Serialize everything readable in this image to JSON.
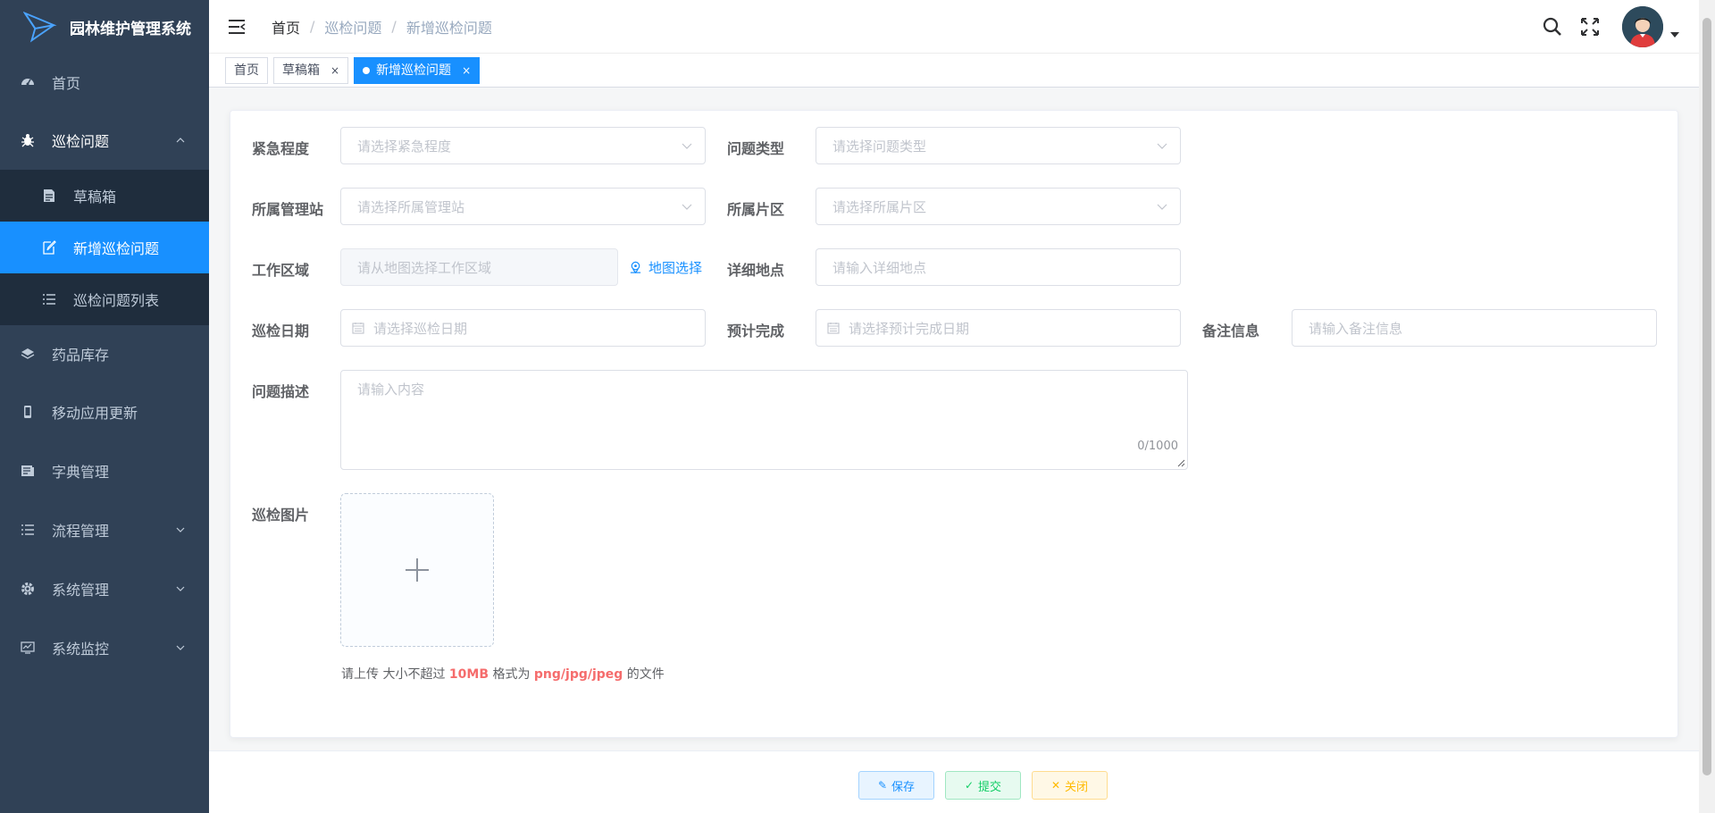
{
  "app": {
    "title": "园林维护管理系统"
  },
  "sidebar": {
    "items": [
      {
        "label": "首页",
        "icon": "dashboard-icon"
      },
      {
        "label": "巡检问题",
        "icon": "bug-icon"
      },
      {
        "label": "药品库存",
        "icon": "layers-icon"
      },
      {
        "label": "移动应用更新",
        "icon": "phone-icon"
      },
      {
        "label": "字典管理",
        "icon": "dict-icon"
      },
      {
        "label": "流程管理",
        "icon": "list-icon"
      },
      {
        "label": "系统管理",
        "icon": "gear-icon"
      },
      {
        "label": "系统监控",
        "icon": "monitor-icon"
      }
    ],
    "submenu": [
      {
        "label": "草稿箱",
        "icon": "document-icon"
      },
      {
        "label": "新增巡检问题",
        "icon": "edit-icon"
      },
      {
        "label": "巡检问题列表",
        "icon": "list-icon"
      }
    ]
  },
  "breadcrumb": {
    "home": "首页",
    "level1": "巡检问题",
    "level2": "新增巡检问题"
  },
  "tags": {
    "home": "首页",
    "draft": "草稿箱",
    "current": "新增巡检问题",
    "close": "×"
  },
  "form": {
    "urgency": {
      "label": "紧急程度",
      "placeholder": "请选择紧急程度"
    },
    "problem_type": {
      "label": "问题类型",
      "placeholder": "请选择问题类型"
    },
    "station": {
      "label": "所属管理站",
      "placeholder": "请选择所属管理站"
    },
    "district": {
      "label": "所属片区",
      "placeholder": "请选择所属片区"
    },
    "work_area": {
      "label": "工作区域",
      "placeholder": "请从地图选择工作区域",
      "map_link": "地图选择"
    },
    "detail_address": {
      "label": "详细地点",
      "placeholder": "请输入详细地点"
    },
    "inspect_date": {
      "label": "巡检日期",
      "placeholder": "请选择巡检日期"
    },
    "expected_date": {
      "label": "预计完成",
      "placeholder": "请选择预计完成日期"
    },
    "remark": {
      "label": "备注信息",
      "placeholder": "请输入备注信息"
    },
    "description": {
      "label": "问题描述",
      "placeholder": "请输入内容",
      "count": "0/1000"
    },
    "images": {
      "label": "巡检图片"
    },
    "upload_hint": {
      "prefix": "请上传",
      "size_text": " 大小不超过 ",
      "size": "10MB",
      "format_text": " 格式为 ",
      "formats": "png/jpg/jpeg",
      "suffix": " 的文件"
    }
  },
  "footer": {
    "save": "保存",
    "submit": "提交",
    "close": "关闭"
  },
  "colors": {
    "sidebar_bg": "#304156",
    "submenu_bg": "#1f2d3d",
    "accent": "#1890ff",
    "success": "#13ce66",
    "warning": "#ffba00",
    "danger": "#f56c6c"
  }
}
